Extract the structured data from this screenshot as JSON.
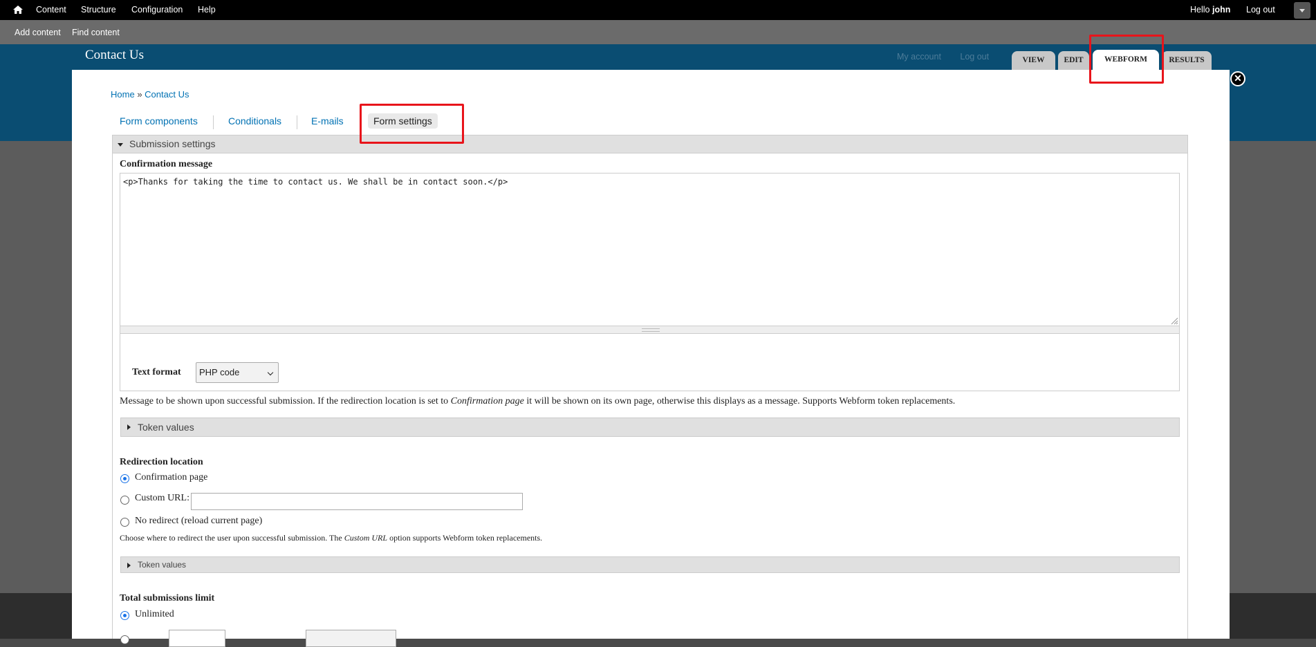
{
  "toolbar": {
    "menu": [
      "Content",
      "Structure",
      "Configuration",
      "Help"
    ],
    "greeting": "Hello",
    "user": "john",
    "logout": "Log out"
  },
  "shortcuts": [
    "Add content",
    "Find content"
  ],
  "header": {
    "site_title": "Contact Us",
    "links": [
      "My account",
      "Log out"
    ]
  },
  "primary_tabs": [
    "VIEW",
    "EDIT",
    "WEBFORM",
    "RESULTS"
  ],
  "primary_tabs_active": "WEBFORM",
  "breadcrumb": {
    "home": "Home",
    "separator": "»",
    "current": "Contact Us"
  },
  "secondary_tabs": [
    "Form components",
    "Conditionals",
    "E-mails",
    "Form settings"
  ],
  "secondary_tabs_active": "Form settings",
  "submission_settings": {
    "legend": "Submission settings",
    "confirmation": {
      "label": "Confirmation message",
      "value": "<p>Thanks for taking the time to contact us. We shall be in contact soon.</p>",
      "text_format_label": "Text format",
      "text_format_value": "PHP code",
      "desc_before": "Message to be shown upon successful submission. If the redirection location is set to ",
      "desc_em": "Confirmation page",
      "desc_after": " it will be shown on its own page, otherwise this displays as a message. Supports Webform token replacements.",
      "token_values": "Token values"
    },
    "redirection": {
      "label": "Redirection location",
      "options": [
        "Confirmation page",
        "Custom URL:",
        "No redirect (reload current page)"
      ],
      "selected": "Confirmation page",
      "custom_url_value": "",
      "desc_before": "Choose where to redirect the user upon successful submission. The ",
      "desc_em": "Custom URL",
      "desc_after": " option supports Webform token replacements.",
      "token_values": "Token values"
    },
    "total_limit": {
      "label": "Total submissions limit",
      "options": [
        "Unlimited"
      ],
      "selected": "Unlimited"
    }
  },
  "colors": {
    "toolbar_bg": "#000000",
    "shortcuts_bg": "#6b6b6b",
    "header_bg": "#0a4d72",
    "link": "#0071b3",
    "highlight": "#e8141b",
    "radio_checked": "#1a73e8"
  }
}
